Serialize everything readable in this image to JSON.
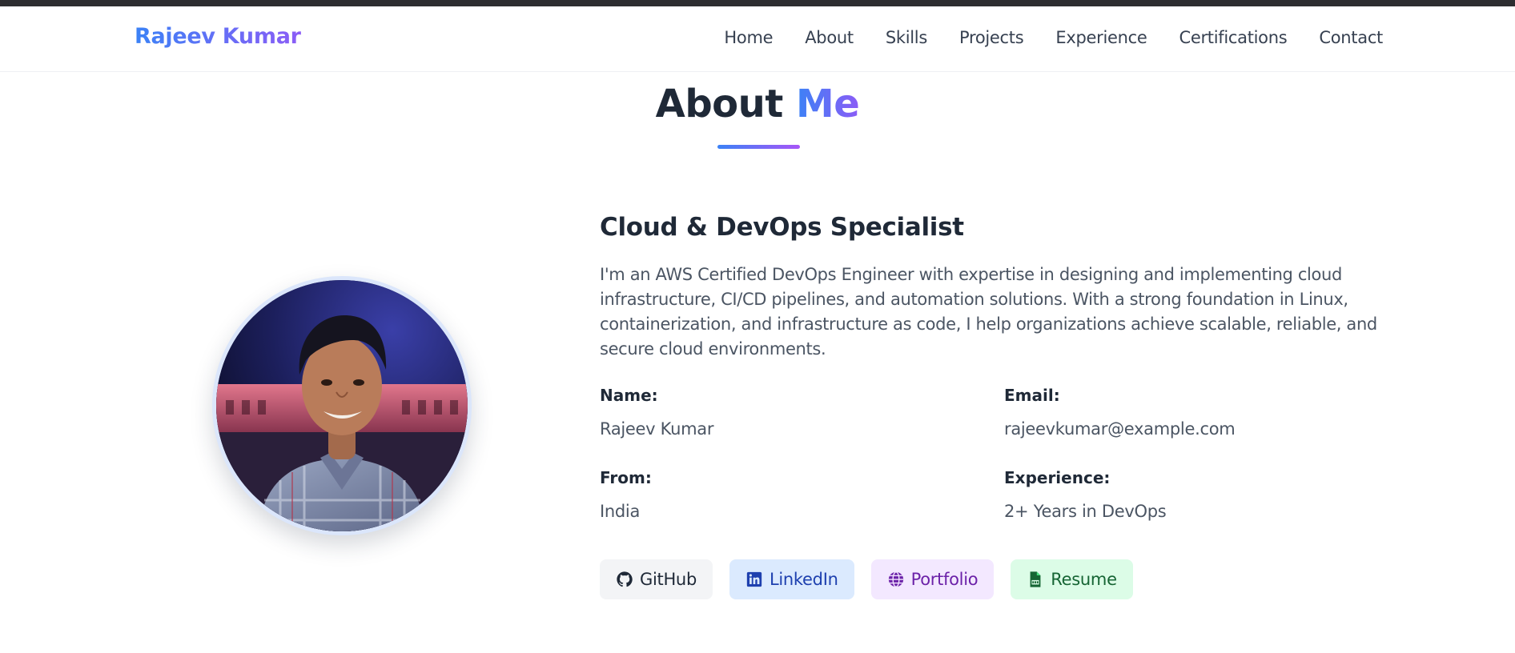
{
  "brand": {
    "name": "Rajeev Kumar"
  },
  "nav": {
    "items": [
      "Home",
      "About",
      "Skills",
      "Projects",
      "Experience",
      "Certifications",
      "Contact"
    ]
  },
  "about": {
    "title_main": "About",
    "title_accent": "Me",
    "subtitle": "Cloud & DevOps Specialist",
    "bio": "I'm an AWS Certified DevOps Engineer with expertise in designing and implementing cloud infrastructure, CI/CD pipelines, and automation solutions. With a strong foundation in Linux, containerization, and infrastructure as code, I help organizations achieve scalable, reliable, and secure cloud environments.",
    "info": {
      "name_label": "Name:",
      "name_value": "Rajeev Kumar",
      "email_label": "Email:",
      "email_value": "rajeevkumar@example.com",
      "from_label": "From:",
      "from_value": "India",
      "experience_label": "Experience:",
      "experience_value": "2+ Years in DevOps"
    },
    "links": [
      {
        "label": "GitHub",
        "icon": "github-icon"
      },
      {
        "label": "LinkedIn",
        "icon": "linkedin-icon"
      },
      {
        "label": "Portfolio",
        "icon": "globe-icon"
      },
      {
        "label": "Resume",
        "icon": "pdf-file-icon"
      }
    ]
  },
  "colors": {
    "accent_start": "#3b82f6",
    "accent_end": "#8b5cf6",
    "heading": "#1f2937",
    "body_text": "#4b5563"
  }
}
